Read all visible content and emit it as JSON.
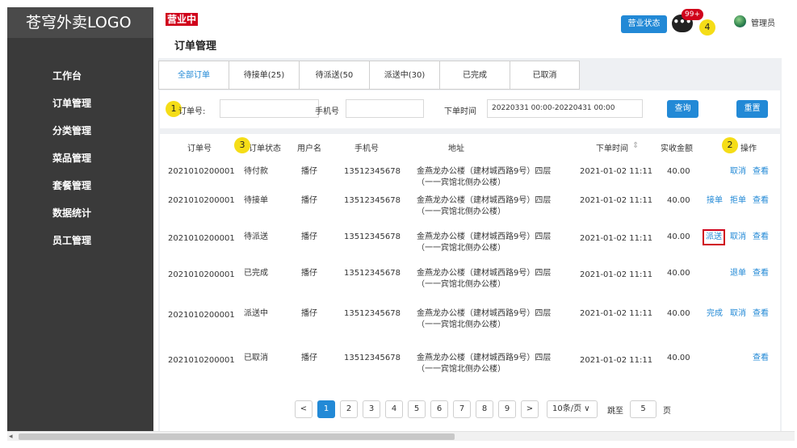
{
  "app": {
    "logo": "苍穹外卖LOGO",
    "status_badge": "营业中",
    "page_title": "订单管理",
    "status_button": "营业状态",
    "message_icon_text": "•••",
    "message_count": "99+",
    "admin_label": "管理员"
  },
  "sidebar": {
    "items": [
      {
        "label": "工作台"
      },
      {
        "label": "订单管理"
      },
      {
        "label": "分类管理"
      },
      {
        "label": "菜品管理"
      },
      {
        "label": "套餐管理"
      },
      {
        "label": "数据统计"
      },
      {
        "label": "员工管理"
      }
    ]
  },
  "tabs": [
    {
      "label": "全部订单",
      "active": true
    },
    {
      "label": "待接单(25)"
    },
    {
      "label": "待派送(50"
    },
    {
      "label": "派送中(30)"
    },
    {
      "label": "已完成"
    },
    {
      "label": "已取消"
    }
  ],
  "filter": {
    "order_no_label": "订单号:",
    "order_no_value": "",
    "phone_label": "手机号",
    "phone_value": "",
    "time_label": "下单时间",
    "time_value": "20220331 00:00-20220431 00:00",
    "search_button": "查询",
    "reset_button": "重置"
  },
  "markers": {
    "m1": "1",
    "m2": "2",
    "m3": "3",
    "m4": "4"
  },
  "table": {
    "headers": {
      "order_no": "订单号",
      "status": "订单状态",
      "user": "用户名",
      "phone": "手机号",
      "address": "地址",
      "time": "下单时间",
      "sort_icon": "⇕",
      "amount": "实收金额",
      "ops": "操作"
    },
    "rows": [
      {
        "order_no": "2021010200001",
        "status": "待付款",
        "user": "播仔",
        "phone": "13512345678",
        "address": "金燕龙办公楼（建材城西路9号）四层（一一宾馆北侧办公楼）",
        "time": "2021-01-02 11:11",
        "amount": "40.00",
        "ops": [
          "取消",
          "查看"
        ]
      },
      {
        "order_no": "2021010200001",
        "status": "待接单",
        "user": "播仔",
        "phone": "13512345678",
        "address": "金燕龙办公楼（建材城西路9号）四层（一一宾馆北侧办公楼）",
        "time": "2021-01-02 11:11",
        "amount": "40.00",
        "ops": [
          "接单",
          "拒单",
          "查看"
        ]
      },
      {
        "order_no": "2021010200001",
        "status": "待派送",
        "user": "播仔",
        "phone": "13512345678",
        "address": "金燕龙办公楼（建材城西路9号）四层（一一宾馆北侧办公楼）",
        "time": "2021-01-02 11:11",
        "amount": "40.00",
        "ops": [
          "派送",
          "取消",
          "查看"
        ]
      },
      {
        "order_no": "2021010200001",
        "status": "已完成",
        "user": "播仔",
        "phone": "13512345678",
        "address": "金燕龙办公楼（建材城西路9号）四层（一一宾馆北侧办公楼）",
        "time": "2021-01-02 11:11",
        "amount": "40.00",
        "ops": [
          "退单",
          "查看"
        ]
      },
      {
        "order_no": "2021010200001",
        "status": "派送中",
        "user": "播仔",
        "phone": "13512345678",
        "address": "金燕龙办公楼（建材城西路9号）四层（一一宾馆北侧办公楼）",
        "time": "2021-01-02 11:11",
        "amount": "40.00",
        "ops": [
          "完成",
          "取消",
          "查看"
        ]
      },
      {
        "order_no": "2021010200001",
        "status": "已取消",
        "user": "播仔",
        "phone": "13512345678",
        "address": "金燕龙办公楼（建材城西路9号）四层（一一宾馆北侧办公楼）",
        "time": "2021-01-02 11:11",
        "amount": "40.00",
        "ops": [
          "查看"
        ]
      }
    ]
  },
  "pagination": {
    "prev": "<",
    "next": ">",
    "pages": [
      "1",
      "2",
      "3",
      "4",
      "5",
      "6",
      "7",
      "8",
      "9"
    ],
    "current": "1",
    "page_size": "10条/页 ∨",
    "jump_label": "跳至",
    "jump_value": "5",
    "page_suffix": "页"
  },
  "scrollbar": {
    "left_arrow": "◂"
  }
}
